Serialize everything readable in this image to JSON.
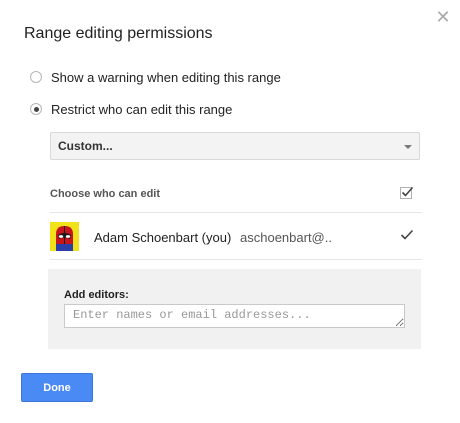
{
  "dialog": {
    "title": "Range editing permissions",
    "close_icon": "close-icon"
  },
  "options": [
    {
      "label": "Show a warning when editing this range",
      "selected": false
    },
    {
      "label": "Restrict who can edit this range",
      "selected": true
    }
  ],
  "restriction_select": {
    "value": "Custom..."
  },
  "editors_section": {
    "label": "Choose who can edit",
    "all_checked": true,
    "editors": [
      {
        "name": "Adam Schoenbart (you)",
        "email": "aschoenbart@..",
        "checked": true,
        "avatar_icon": "superhero-avatar-icon"
      }
    ]
  },
  "add_editors": {
    "label": "Add editors:",
    "placeholder": "Enter names or email addresses..."
  },
  "done_button": {
    "label": "Done"
  },
  "colors": {
    "primary": "#4a8af4",
    "panel": "#f1f1f1",
    "avatar_bg": "#f2e21a"
  }
}
